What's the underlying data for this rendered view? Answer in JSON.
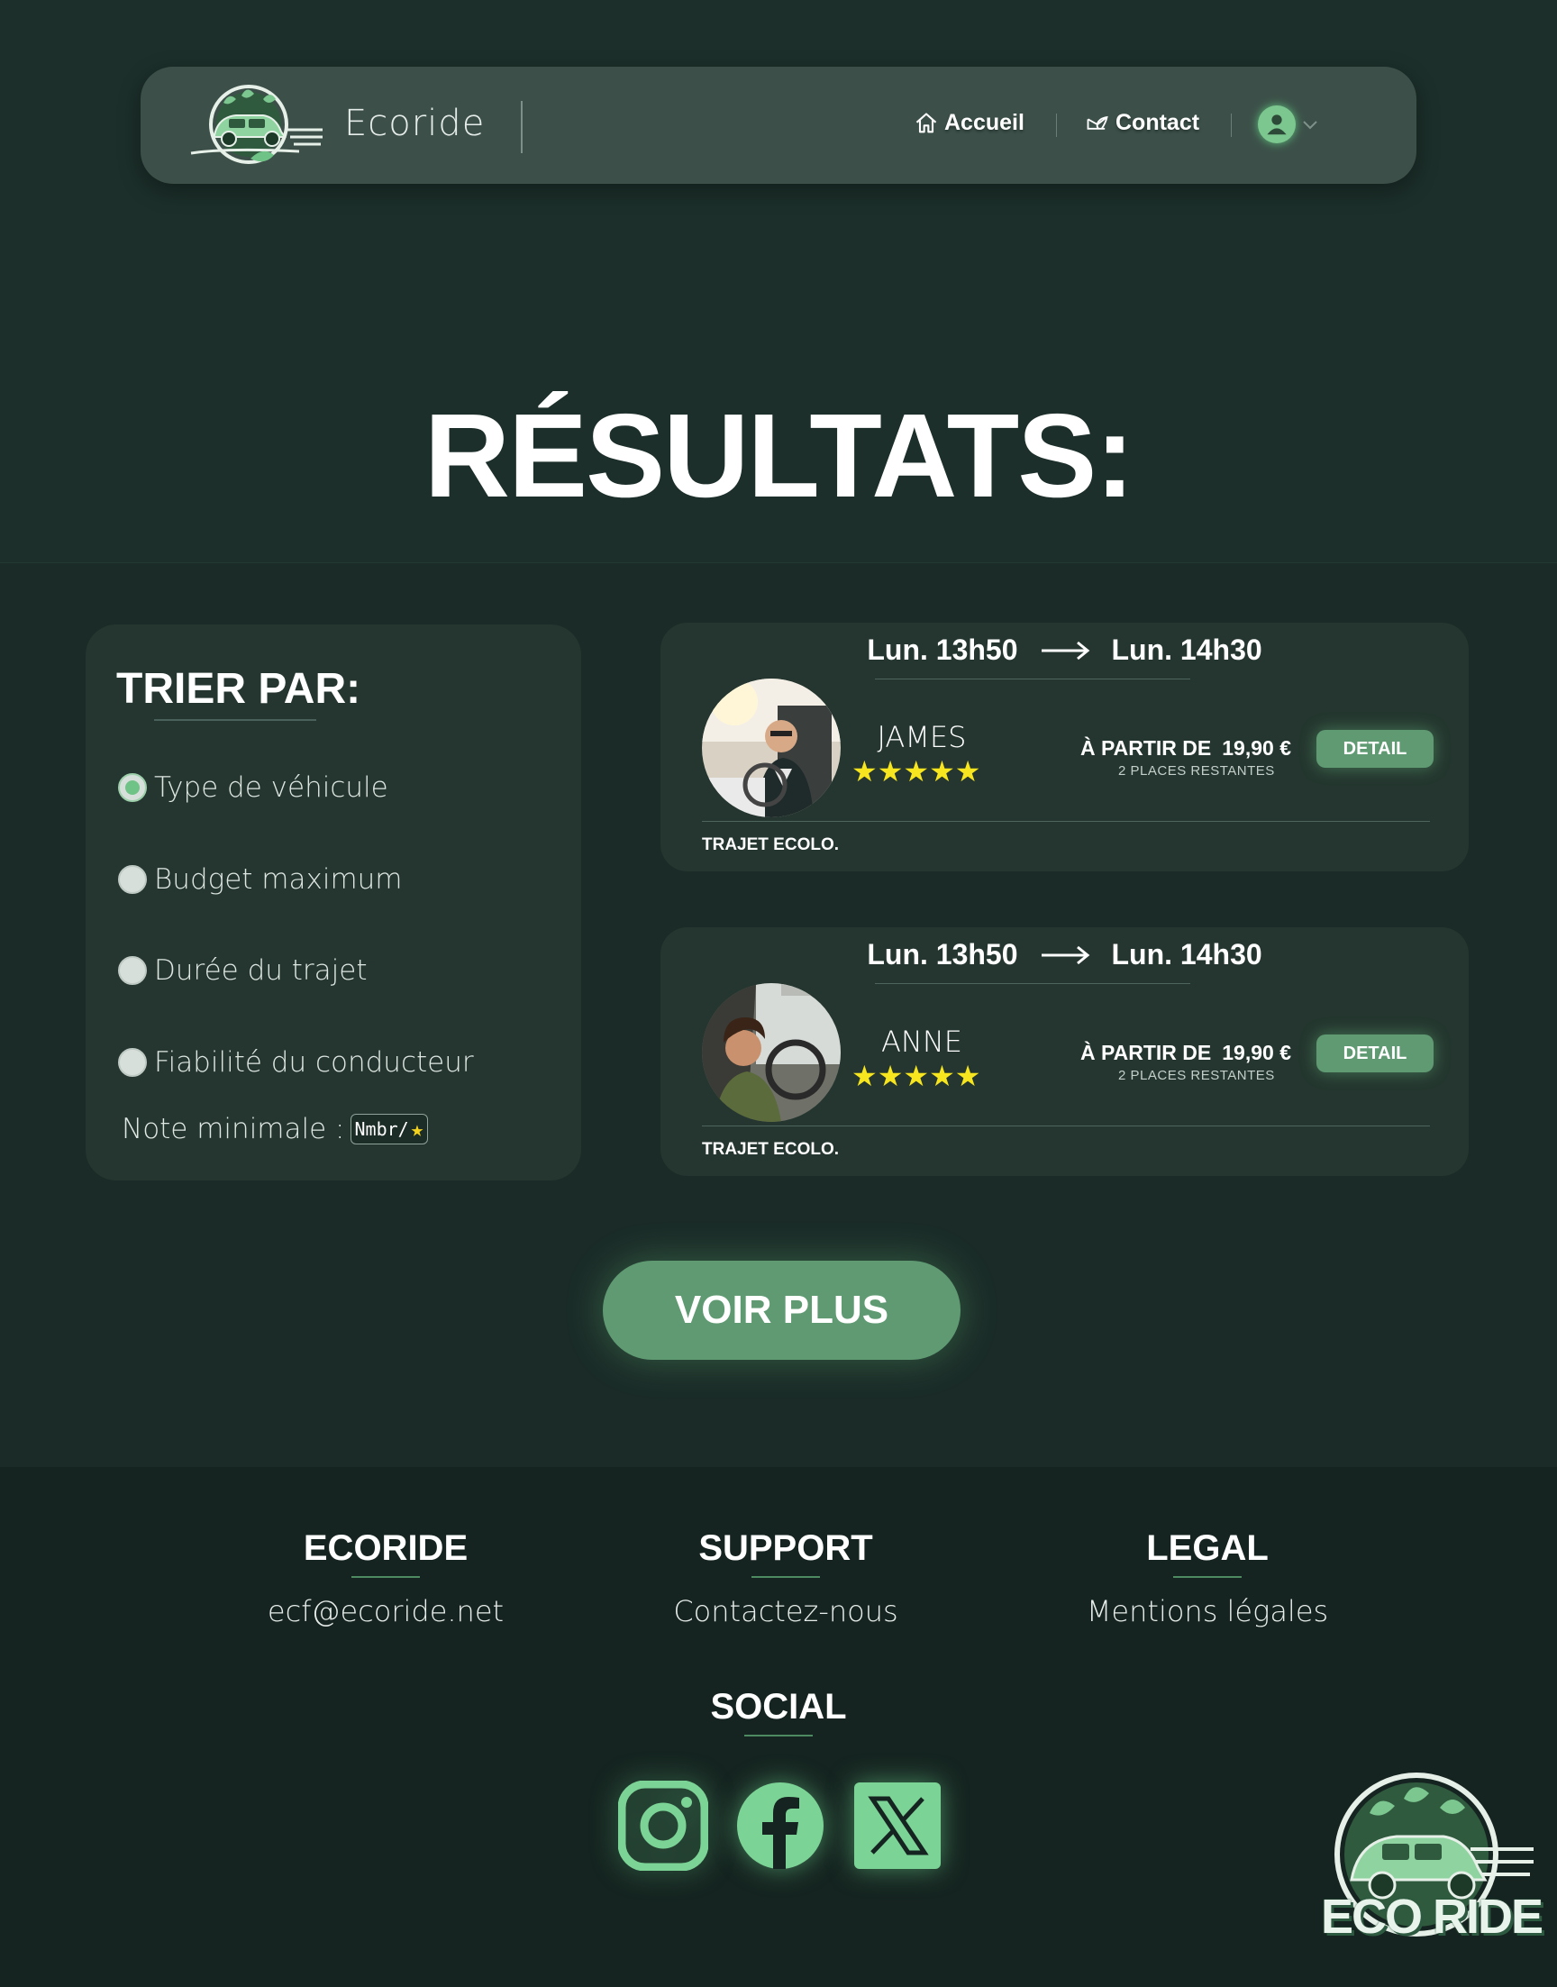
{
  "navbar": {
    "brand": "Ecoride",
    "links": [
      {
        "label": "Accueil",
        "icon": "home-icon"
      },
      {
        "label": "Contact",
        "icon": "leaf-mail-icon"
      }
    ],
    "user_icon": "user-avatar-icon"
  },
  "page": {
    "title": "RÉSULTATS:"
  },
  "sort": {
    "title": "TRIER PAR:",
    "options": [
      {
        "label": "Type de véhicule",
        "checked": true
      },
      {
        "label": "Budget maximum",
        "checked": false
      },
      {
        "label": "Durée du trajet",
        "checked": false
      },
      {
        "label": "Fiabilité du conducteur",
        "checked": false
      }
    ],
    "min_rating_label": "Note minimale :",
    "min_rating_placeholder": "Nmbr/"
  },
  "rides": [
    {
      "departure": "Lun. 13h50",
      "arrival": "Lun. 14h30",
      "driver": "JAMES",
      "rating": 5,
      "stars": "★★★★★",
      "price_prefix": "À PARTIR DE",
      "price": "19,90 €",
      "seats": "2 PLACES RESTANTES",
      "detail": "DETAIL",
      "tag": "TRAJET ECOLO."
    },
    {
      "departure": "Lun. 13h50",
      "arrival": "Lun. 14h30",
      "driver": "ANNE",
      "rating": 5,
      "stars": "★★★★★",
      "price_prefix": "À PARTIR DE",
      "price": "19,90 €",
      "seats": "2 PLACES RESTANTES",
      "detail": "DETAIL",
      "tag": "TRAJET ECOLO."
    }
  ],
  "see_more": "VOIR PLUS",
  "footer": {
    "columns": [
      {
        "heading": "ECORIDE",
        "link": "ecf@ecoride.net"
      },
      {
        "heading": "SUPPORT",
        "link": "Contactez-nous"
      },
      {
        "heading": "LEGAL",
        "link": "Mentions légales"
      }
    ],
    "social_heading": "SOCIAL",
    "social": [
      "instagram-icon",
      "facebook-icon",
      "x-icon"
    ],
    "logo_text": "ECO RIDE"
  },
  "colors": {
    "background": "#1b2c28",
    "card": "#24362f",
    "accent": "#5f9a72",
    "star": "#f7e51f"
  }
}
